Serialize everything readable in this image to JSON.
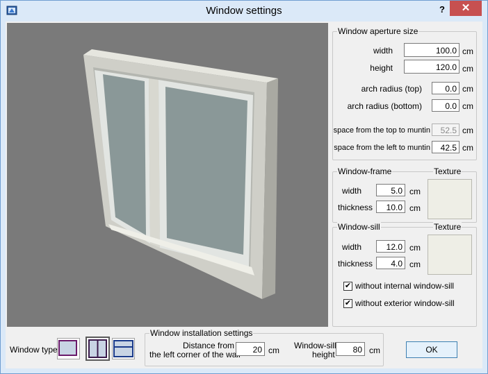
{
  "window": {
    "title": "Window settings",
    "help": "?",
    "close": "✕"
  },
  "aperture": {
    "group_label": "Window aperture size",
    "width_label": "width",
    "width_value": "100.0",
    "width_unit": "cm",
    "height_label": "height",
    "height_value": "120.0",
    "height_unit": "cm",
    "arch_top_label": "arch radius (top)",
    "arch_top_value": "0.0",
    "arch_top_unit": "cm",
    "arch_bottom_label": "arch radius (bottom)",
    "arch_bottom_value": "0.0",
    "arch_bottom_unit": "cm",
    "space_top_label": "space from the top to muntin",
    "space_top_value": "52.5",
    "space_top_unit": "cm",
    "space_left_label": "space from the left to muntin",
    "space_left_value": "42.5",
    "space_left_unit": "cm"
  },
  "frame": {
    "group_label": "Window-frame",
    "texture_label": "Texture",
    "width_label": "width",
    "width_value": "5.0",
    "width_unit": "cm",
    "thickness_label": "thickness",
    "thickness_value": "10.0",
    "thickness_unit": "cm"
  },
  "sill": {
    "group_label": "Window-sill",
    "texture_label": "Texture",
    "width_label": "width",
    "width_value": "12.0",
    "width_unit": "cm",
    "thickness_label": "thickness",
    "thickness_value": "4.0",
    "thickness_unit": "cm",
    "internal_label": "without internal window-sill",
    "internal_checked": true,
    "exterior_label": "without exterior window-sill",
    "exterior_checked": true
  },
  "bottom": {
    "window_type_label": "Window type",
    "installation_group_label": "Window installation settings",
    "distance_label_1": "Distance from",
    "distance_label_2": "the left corner of the wall",
    "distance_value": "20",
    "distance_unit": "cm",
    "sill_height_label_1": "Window-sill",
    "sill_height_label_2": "height",
    "sill_height_value": "80",
    "sill_height_unit": "cm",
    "ok_label": "OK"
  },
  "icons": {
    "app": "app-icon",
    "check": "✔"
  }
}
